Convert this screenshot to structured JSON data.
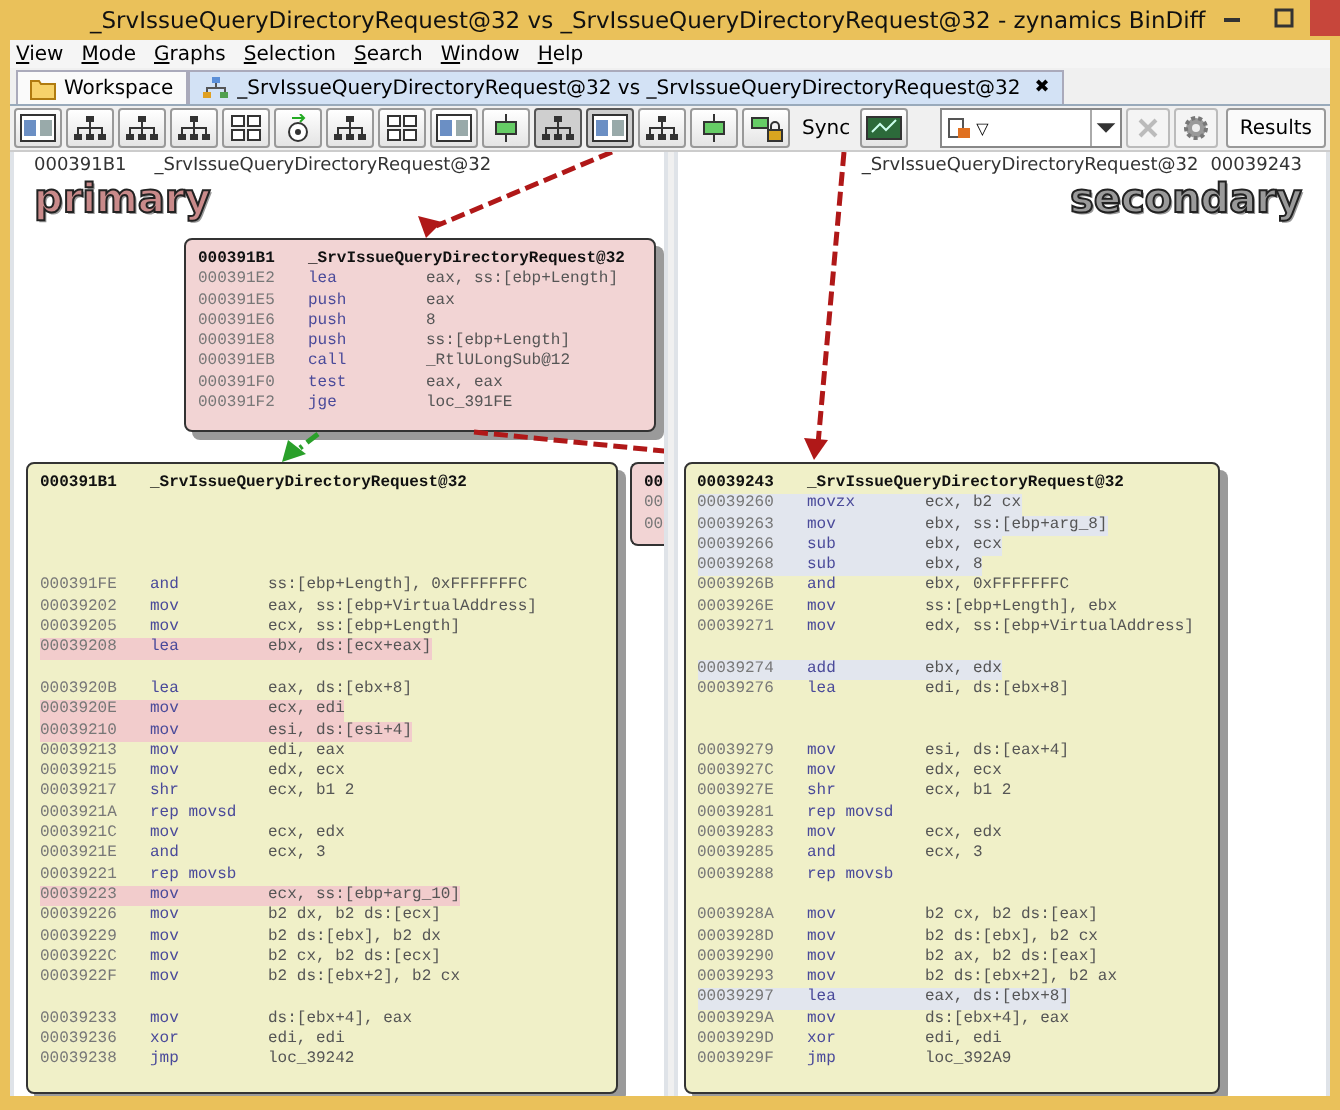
{
  "window": {
    "title": "_SrvIssueQueryDirectoryRequest@32 vs _SrvIssueQueryDirectoryRequest@32 - zynamics BinDiff"
  },
  "menu": [
    "View",
    "Mode",
    "Graphs",
    "Selection",
    "Search",
    "Window",
    "Help"
  ],
  "tabs": [
    {
      "label": "Workspace",
      "selected": false
    },
    {
      "label": "_SrvIssueQueryDirectoryRequest@32 vs _SrvIssueQueryDirectoryRequest@32",
      "selected": true,
      "close": "✖"
    }
  ],
  "toolbar": {
    "buttons": [
      {
        "kind": "panels",
        "pressed": false
      },
      {
        "kind": "tree",
        "pressed": false
      },
      {
        "kind": "tree",
        "pressed": false
      },
      {
        "kind": "tree",
        "pressed": false
      },
      {
        "kind": "grid",
        "pressed": false
      },
      {
        "kind": "circle",
        "pressed": false
      },
      {
        "kind": "tree",
        "pressed": false
      },
      {
        "kind": "grid",
        "pressed": false
      },
      {
        "kind": "panels",
        "pressed": false
      },
      {
        "kind": "node",
        "pressed": false
      },
      {
        "kind": "tree",
        "pressed": true
      },
      {
        "kind": "panels",
        "pressed": true
      },
      {
        "kind": "tree",
        "pressed": false
      },
      {
        "kind": "node",
        "pressed": false
      },
      {
        "kind": "lock",
        "pressed": false
      }
    ],
    "sync_label": "Sync",
    "combo_caret": "▽",
    "results": "Results"
  },
  "panels": [
    {
      "address": "000391B1",
      "name": "_SrvIssueQueryDirectoryRequest@32",
      "label": "primary",
      "edges": [
        {
          "color": "#b01818"
        },
        {
          "color": "#b01818"
        },
        {
          "color": "#2aa02a"
        }
      ],
      "nodes": [
        {
          "kind": "block",
          "color": "#f2d4d4",
          "title_address": "000391B1",
          "title_name": "_SrvIssueQueryDirectoryRequest@32",
          "rows": [
            {
              "kind": "instr",
              "address": "000391E2",
              "mnemonic": "lea",
              "operands": "eax, ss:[ebp+Length]"
            },
            {
              "kind": "instr",
              "address": "000391E5",
              "mnemonic": "push",
              "operands": "eax"
            },
            {
              "kind": "instr",
              "address": "000391E6",
              "mnemonic": "push",
              "operands": "8"
            },
            {
              "kind": "instr",
              "address": "000391E8",
              "mnemonic": "push",
              "operands": "ss:[ebp+Length]"
            },
            {
              "kind": "instr",
              "address": "000391EB",
              "mnemonic": "call",
              "operands": "_RtlULongSub@12"
            },
            {
              "kind": "instr",
              "address": "000391F0",
              "mnemonic": "test",
              "operands": "eax, eax"
            },
            {
              "kind": "instr",
              "address": "000391F2",
              "mnemonic": "jge",
              "operands": "loc_391FE"
            }
          ]
        },
        {
          "kind": "block",
          "color": "#f0f0c8",
          "title_address": "000391B1",
          "title_name": "_SrvIssueQueryDirectoryRequest@32",
          "rows": [
            {
              "kind": "gap"
            },
            {
              "kind": "gap"
            },
            {
              "kind": "gap"
            },
            {
              "kind": "gap"
            },
            {
              "kind": "instr",
              "address": "000391FE",
              "mnemonic": "and",
              "operands": "ss:[ebp+Length], 0xFFFFFFFC",
              "highlighted": false
            },
            {
              "kind": "instr",
              "address": "00039202",
              "mnemonic": "mov",
              "operands": "eax, ss:[ebp+VirtualAddress]",
              "highlighted": false
            },
            {
              "kind": "instr",
              "address": "00039205",
              "mnemonic": "mov",
              "operands": "ecx, ss:[ebp+Length]",
              "highlighted": false
            },
            {
              "kind": "instr",
              "address": "00039208",
              "mnemonic": "lea",
              "operands": "ebx, ds:[ecx+eax]",
              "highlighted": true
            },
            {
              "kind": "gap"
            },
            {
              "kind": "instr",
              "address": "0003920B",
              "mnemonic": "lea",
              "operands": "eax, ds:[ebx+8]",
              "highlighted": false
            },
            {
              "kind": "instr",
              "address": "0003920E",
              "mnemonic": "mov",
              "operands": "ecx, edi",
              "highlighted": true
            },
            {
              "kind": "instr",
              "address": "00039210",
              "mnemonic": "mov",
              "operands": "esi, ds:[esi+4]",
              "highlighted": true
            },
            {
              "kind": "instr",
              "address": "00039213",
              "mnemonic": "mov",
              "operands": "edi, eax",
              "highlighted": false
            },
            {
              "kind": "instr",
              "address": "00039215",
              "mnemonic": "mov",
              "operands": "edx, ecx",
              "highlighted": false
            },
            {
              "kind": "instr",
              "address": "00039217",
              "mnemonic": "shr",
              "operands": "ecx, b1 2",
              "highlighted": false
            },
            {
              "kind": "instr",
              "address": "0003921A",
              "mnemonic": "rep movsd",
              "operands": "",
              "highlighted": false
            },
            {
              "kind": "instr",
              "address": "0003921C",
              "mnemonic": "mov",
              "operands": "ecx, edx",
              "highlighted": false
            },
            {
              "kind": "instr",
              "address": "0003921E",
              "mnemonic": "and",
              "operands": "ecx, 3",
              "highlighted": false
            },
            {
              "kind": "instr",
              "address": "00039221",
              "mnemonic": "rep movsb",
              "operands": "",
              "highlighted": false
            },
            {
              "kind": "instr",
              "address": "00039223",
              "mnemonic": "mov",
              "operands": "ecx, ss:[ebp+arg_10]",
              "highlighted": true
            },
            {
              "kind": "instr",
              "address": "00039226",
              "mnemonic": "mov",
              "operands": "b2 dx, b2 ds:[ecx]",
              "highlighted": false
            },
            {
              "kind": "instr",
              "address": "00039229",
              "mnemonic": "mov",
              "operands": "b2 ds:[ebx], b2 dx",
              "highlighted": false
            },
            {
              "kind": "instr",
              "address": "0003922C",
              "mnemonic": "mov",
              "operands": "b2 cx, b2 ds:[ecx]",
              "highlighted": false
            },
            {
              "kind": "instr",
              "address": "0003922F",
              "mnemonic": "mov",
              "operands": "b2 ds:[ebx+2], b2 cx",
              "highlighted": false
            },
            {
              "kind": "gap"
            },
            {
              "kind": "instr",
              "address": "00039233",
              "mnemonic": "mov",
              "operands": "ds:[ebx+4], eax",
              "highlighted": false
            },
            {
              "kind": "instr",
              "address": "00039236",
              "mnemonic": "xor",
              "operands": "edi, edi",
              "highlighted": false
            },
            {
              "kind": "instr",
              "address": "00039238",
              "mnemonic": "jmp",
              "operands": "loc_39242",
              "highlighted": false
            }
          ]
        },
        {
          "kind": "stub",
          "color": "#f2d4d4",
          "title_address": "00",
          "rows": [
            {
              "kind": "instr",
              "address": "00"
            },
            {
              "kind": "instr",
              "address": "00"
            }
          ]
        }
      ]
    },
    {
      "address": "00039243",
      "name": "_SrvIssueQueryDirectoryRequest@32",
      "label": "secondary",
      "edges": [
        {
          "color": "#b01818"
        }
      ],
      "nodes": [
        {
          "kind": "block",
          "color": "#f0f0c8",
          "title_address": "00039243",
          "title_name": "_SrvIssueQueryDirectoryRequest@32",
          "rows": [
            {
              "kind": "instr",
              "address": "00039260",
              "mnemonic": "movzx",
              "operands": "ecx, b2 cx",
              "highlighted": true
            },
            {
              "kind": "instr",
              "address": "00039263",
              "mnemonic": "mov",
              "operands": "ebx, ss:[ebp+arg_8]",
              "highlighted": true
            },
            {
              "kind": "instr",
              "address": "00039266",
              "mnemonic": "sub",
              "operands": "ebx, ecx",
              "highlighted": true
            },
            {
              "kind": "instr",
              "address": "00039268",
              "mnemonic": "sub",
              "operands": "ebx, 8",
              "highlighted": true
            },
            {
              "kind": "instr",
              "address": "0003926B",
              "mnemonic": "and",
              "operands": "ebx, 0xFFFFFFFC",
              "highlighted": false
            },
            {
              "kind": "instr",
              "address": "0003926E",
              "mnemonic": "mov",
              "operands": "ss:[ebp+Length], ebx",
              "highlighted": false
            },
            {
              "kind": "instr",
              "address": "00039271",
              "mnemonic": "mov",
              "operands": "edx, ss:[ebp+VirtualAddress]",
              "highlighted": false
            },
            {
              "kind": "gap"
            },
            {
              "kind": "instr",
              "address": "00039274",
              "mnemonic": "add",
              "operands": "ebx, edx",
              "highlighted": true
            },
            {
              "kind": "instr",
              "address": "00039276",
              "mnemonic": "lea",
              "operands": "edi, ds:[ebx+8]",
              "highlighted": false
            },
            {
              "kind": "gap"
            },
            {
              "kind": "gap"
            },
            {
              "kind": "instr",
              "address": "00039279",
              "mnemonic": "mov",
              "operands": "esi, ds:[eax+4]",
              "highlighted": false
            },
            {
              "kind": "instr",
              "address": "0003927C",
              "mnemonic": "mov",
              "operands": "edx, ecx",
              "highlighted": false
            },
            {
              "kind": "instr",
              "address": "0003927E",
              "mnemonic": "shr",
              "operands": "ecx, b1 2",
              "highlighted": false
            },
            {
              "kind": "instr",
              "address": "00039281",
              "mnemonic": "rep movsd",
              "operands": "",
              "highlighted": false
            },
            {
              "kind": "instr",
              "address": "00039283",
              "mnemonic": "mov",
              "operands": "ecx, edx",
              "highlighted": false
            },
            {
              "kind": "instr",
              "address": "00039285",
              "mnemonic": "and",
              "operands": "ecx, 3",
              "highlighted": false
            },
            {
              "kind": "instr",
              "address": "00039288",
              "mnemonic": "rep movsb",
              "operands": "",
              "highlighted": false
            },
            {
              "kind": "gap"
            },
            {
              "kind": "instr",
              "address": "0003928A",
              "mnemonic": "mov",
              "operands": "b2 cx, b2 ds:[eax]",
              "highlighted": false
            },
            {
              "kind": "instr",
              "address": "0003928D",
              "mnemonic": "mov",
              "operands": "b2 ds:[ebx], b2 cx",
              "highlighted": false
            },
            {
              "kind": "instr",
              "address": "00039290",
              "mnemonic": "mov",
              "operands": "b2 ax, b2 ds:[eax]",
              "highlighted": false
            },
            {
              "kind": "instr",
              "address": "00039293",
              "mnemonic": "mov",
              "operands": "b2 ds:[ebx+2], b2 ax",
              "highlighted": false
            },
            {
              "kind": "instr",
              "address": "00039297",
              "mnemonic": "lea",
              "operands": "eax, ds:[ebx+8]",
              "highlighted": true
            },
            {
              "kind": "instr",
              "address": "0003929A",
              "mnemonic": "mov",
              "operands": "ds:[ebx+4], eax",
              "highlighted": false
            },
            {
              "kind": "instr",
              "address": "0003929D",
              "mnemonic": "xor",
              "operands": "edi, edi",
              "highlighted": false
            },
            {
              "kind": "instr",
              "address": "0003929F",
              "mnemonic": "jmp",
              "operands": "loc_392A9",
              "highlighted": false
            }
          ]
        }
      ]
    }
  ]
}
